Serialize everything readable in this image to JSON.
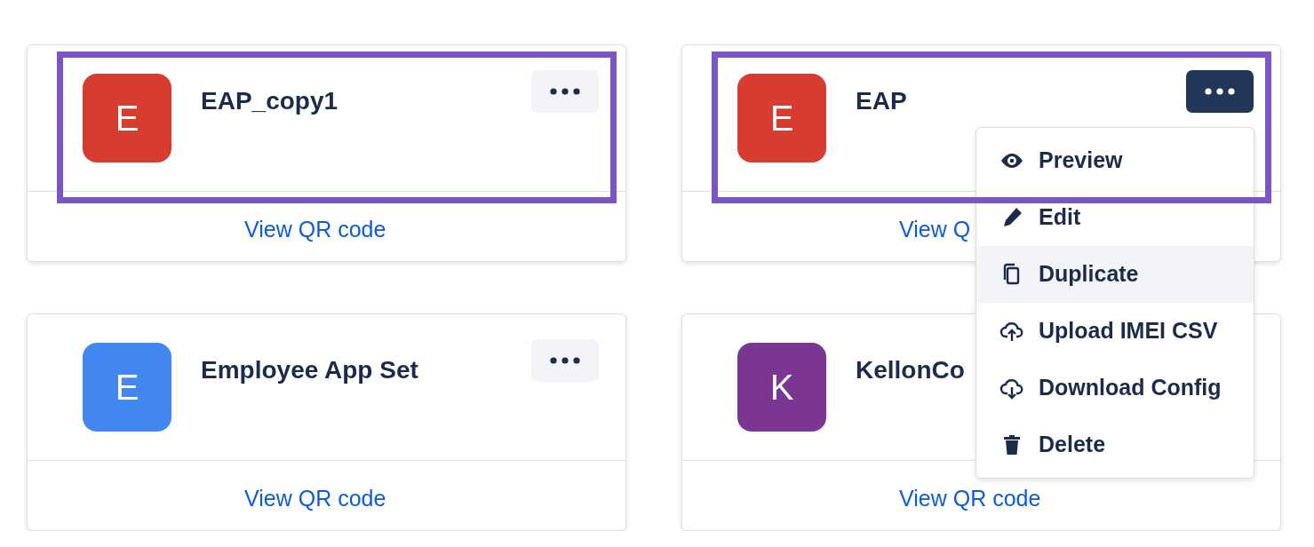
{
  "cards": [
    {
      "initial": "E",
      "color": "#d83b30",
      "name": "EAP_copy1",
      "link": "View QR code",
      "menu_button": {
        "open": false
      },
      "highlighted": true
    },
    {
      "initial": "E",
      "color": "#d83b30",
      "name": "EAP",
      "link": "View Q",
      "menu_button": {
        "open": true
      },
      "highlighted": true,
      "menu": [
        {
          "label": "Preview",
          "selected": false
        },
        {
          "label": "Edit",
          "selected": false
        },
        {
          "label": "Duplicate",
          "selected": true
        },
        {
          "label": "Upload IMEI CSV",
          "selected": false
        },
        {
          "label": "Download Config",
          "selected": false
        },
        {
          "label": "Delete",
          "selected": false
        }
      ]
    },
    {
      "initial": "E",
      "color": "#4287f0",
      "name": "Employee App Set",
      "link": "View QR code",
      "menu_button": {
        "open": false
      },
      "highlighted": false
    },
    {
      "initial": "K",
      "color": "#7b3593",
      "name": "KellonCo",
      "link": "View QR code",
      "highlighted": false
    }
  ]
}
